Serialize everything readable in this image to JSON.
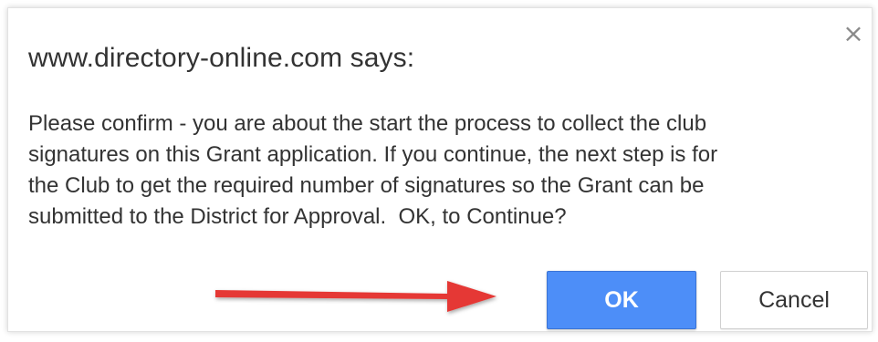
{
  "dialog": {
    "title": "www.directory-online.com says:",
    "message": "Please confirm - you are about the start the process to collect the club\nsignatures on this Grant application. If you continue, the next step is for\nthe Club to get the required number of signatures so the Grant can be\nsubmitted to the District for Approval.  OK, to Continue?",
    "close_icon": "×",
    "ok_label": "OK",
    "cancel_label": "Cancel"
  },
  "colors": {
    "ok_button": "#4d8ef8",
    "annotation_arrow": "#e53935"
  },
  "icons": {
    "close": "close-icon",
    "annotation": "red-arrow-icon"
  }
}
